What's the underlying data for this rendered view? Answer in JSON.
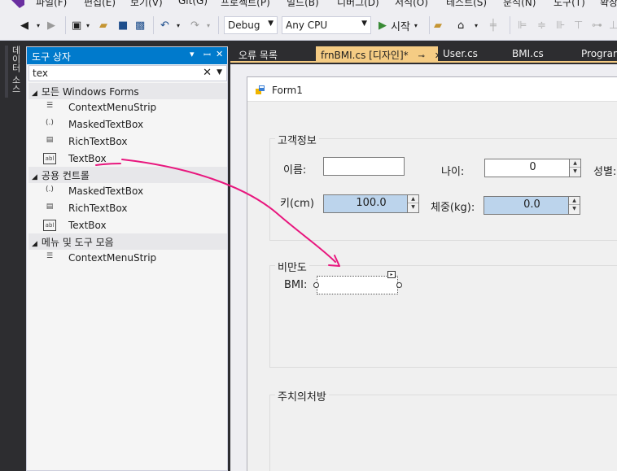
{
  "menubar": {
    "items": [
      "파일(F)",
      "편집(E)",
      "보기(V)",
      "Git(G)",
      "프로젝트(P)",
      "빌드(B)",
      "디버그(D)",
      "서식(O)",
      "테스트(S)",
      "분석(N)",
      "도구(T)",
      "확장"
    ]
  },
  "toolbar": {
    "config": "Debug",
    "platform": "Any CPU",
    "start_label": "시작"
  },
  "rail": {
    "label": "데이터 소스"
  },
  "toolbox": {
    "title": "도구 상자",
    "search_value": "tex",
    "groups": [
      {
        "label": "모든 Windows Forms",
        "items": [
          {
            "icon": "(...)",
            "label": "ContextMenuStrip"
          },
          {
            "icon": "(.)-",
            "label": "MaskedTextBox"
          },
          {
            "icon": "A",
            "label": "RichTextBox"
          },
          {
            "icon": "abl",
            "label": "TextBox"
          }
        ]
      },
      {
        "label": "공용 컨트롤",
        "items": [
          {
            "icon": "(.)-",
            "label": "MaskedTextBox"
          },
          {
            "icon": "A",
            "label": "RichTextBox"
          },
          {
            "icon": "abl",
            "label": "TextBox"
          }
        ]
      },
      {
        "label": "메뉴 및 도구 모음",
        "items": [
          {
            "icon": "(...)",
            "label": "ContextMenuStrip"
          }
        ]
      }
    ]
  },
  "tabs": [
    {
      "label": "오류 목록"
    },
    {
      "label": "frnBMI.cs [디자인]*",
      "active": true
    },
    {
      "label": "User.cs"
    },
    {
      "label": "BMI.cs"
    },
    {
      "label": "Program"
    }
  ],
  "form": {
    "title": "Form1",
    "customer_group": "고객정보",
    "name_label": "이름:",
    "age_label": "나이:",
    "age_value": "0",
    "gender_label": "성별:",
    "height_label": "키(cm)",
    "height_value": "100.0",
    "weight_label": "체중(kg):",
    "weight_value": "0.0",
    "bmi_group": "비만도",
    "bmi_label": "BMI:",
    "rx_group": "주치의처방"
  },
  "colors": {
    "accent": "#007acc",
    "active_tab": "#f5cc84",
    "annotation": "#e8177e"
  }
}
